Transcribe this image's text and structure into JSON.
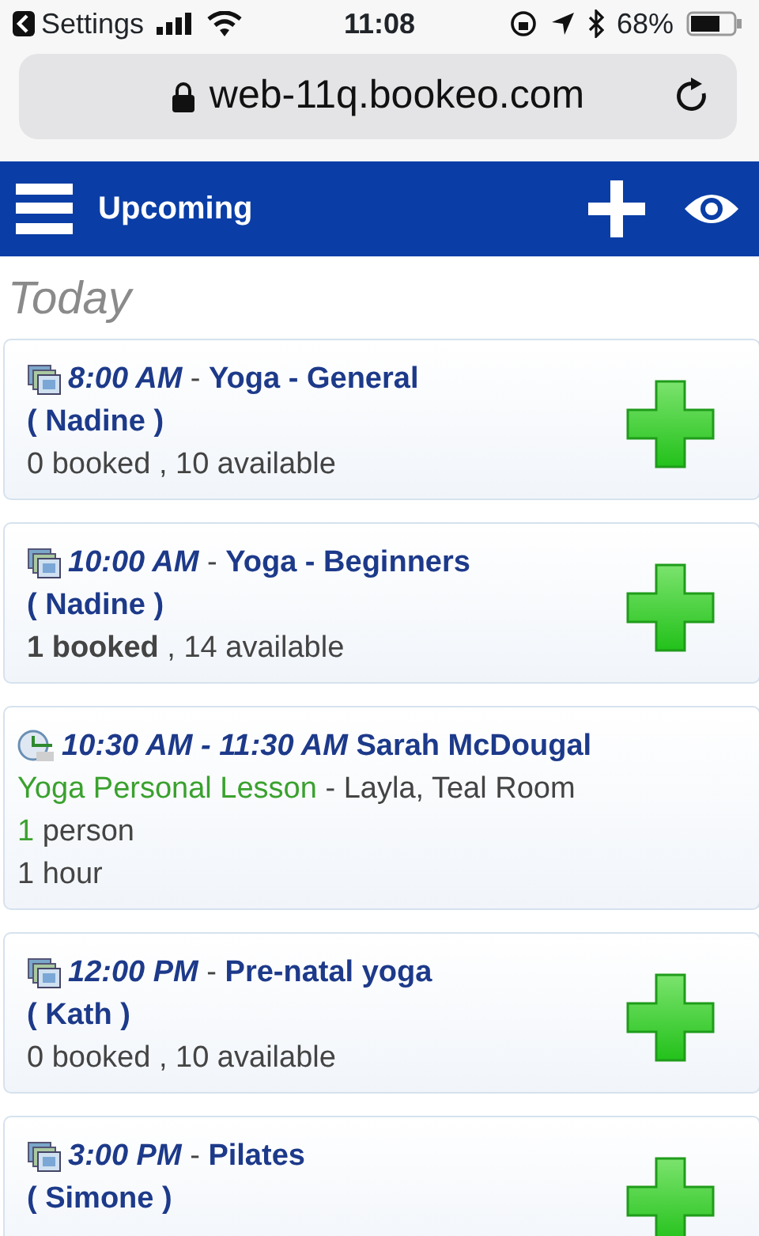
{
  "status_bar": {
    "back_label": "Settings",
    "time": "11:08",
    "battery": "68%"
  },
  "address_bar": {
    "url": "web-11q.bookeo.com"
  },
  "header": {
    "title": "Upcoming"
  },
  "section": {
    "title": "Today"
  },
  "items": [
    {
      "kind": "class",
      "time": "8:00 AM",
      "separator": " - ",
      "title": "Yoga - General",
      "instructor": "( Nadine )",
      "availability": "0 booked , 10 available"
    },
    {
      "kind": "class",
      "time": "10:00 AM",
      "separator": " - ",
      "title": "Yoga - Beginners",
      "instructor": "( Nadine )",
      "availability": "**1 booked** , 14 available"
    },
    {
      "kind": "booking",
      "time": "10:30 AM - 11:30 AM",
      "customer": "Sarah McDougal",
      "product": "Yoga Personal Lesson",
      "details": " - Layla, Teal Room",
      "count": "1",
      "count_label": " person",
      "duration": "1 hour"
    },
    {
      "kind": "class",
      "time": "12:00 PM",
      "separator": " - ",
      "title": "Pre-natal yoga",
      "instructor": "( Kath )",
      "availability": "0 booked , 10 available"
    },
    {
      "kind": "class",
      "time": "3:00 PM",
      "separator": " - ",
      "title": "Pilates",
      "instructor": "( Simone )"
    }
  ]
}
